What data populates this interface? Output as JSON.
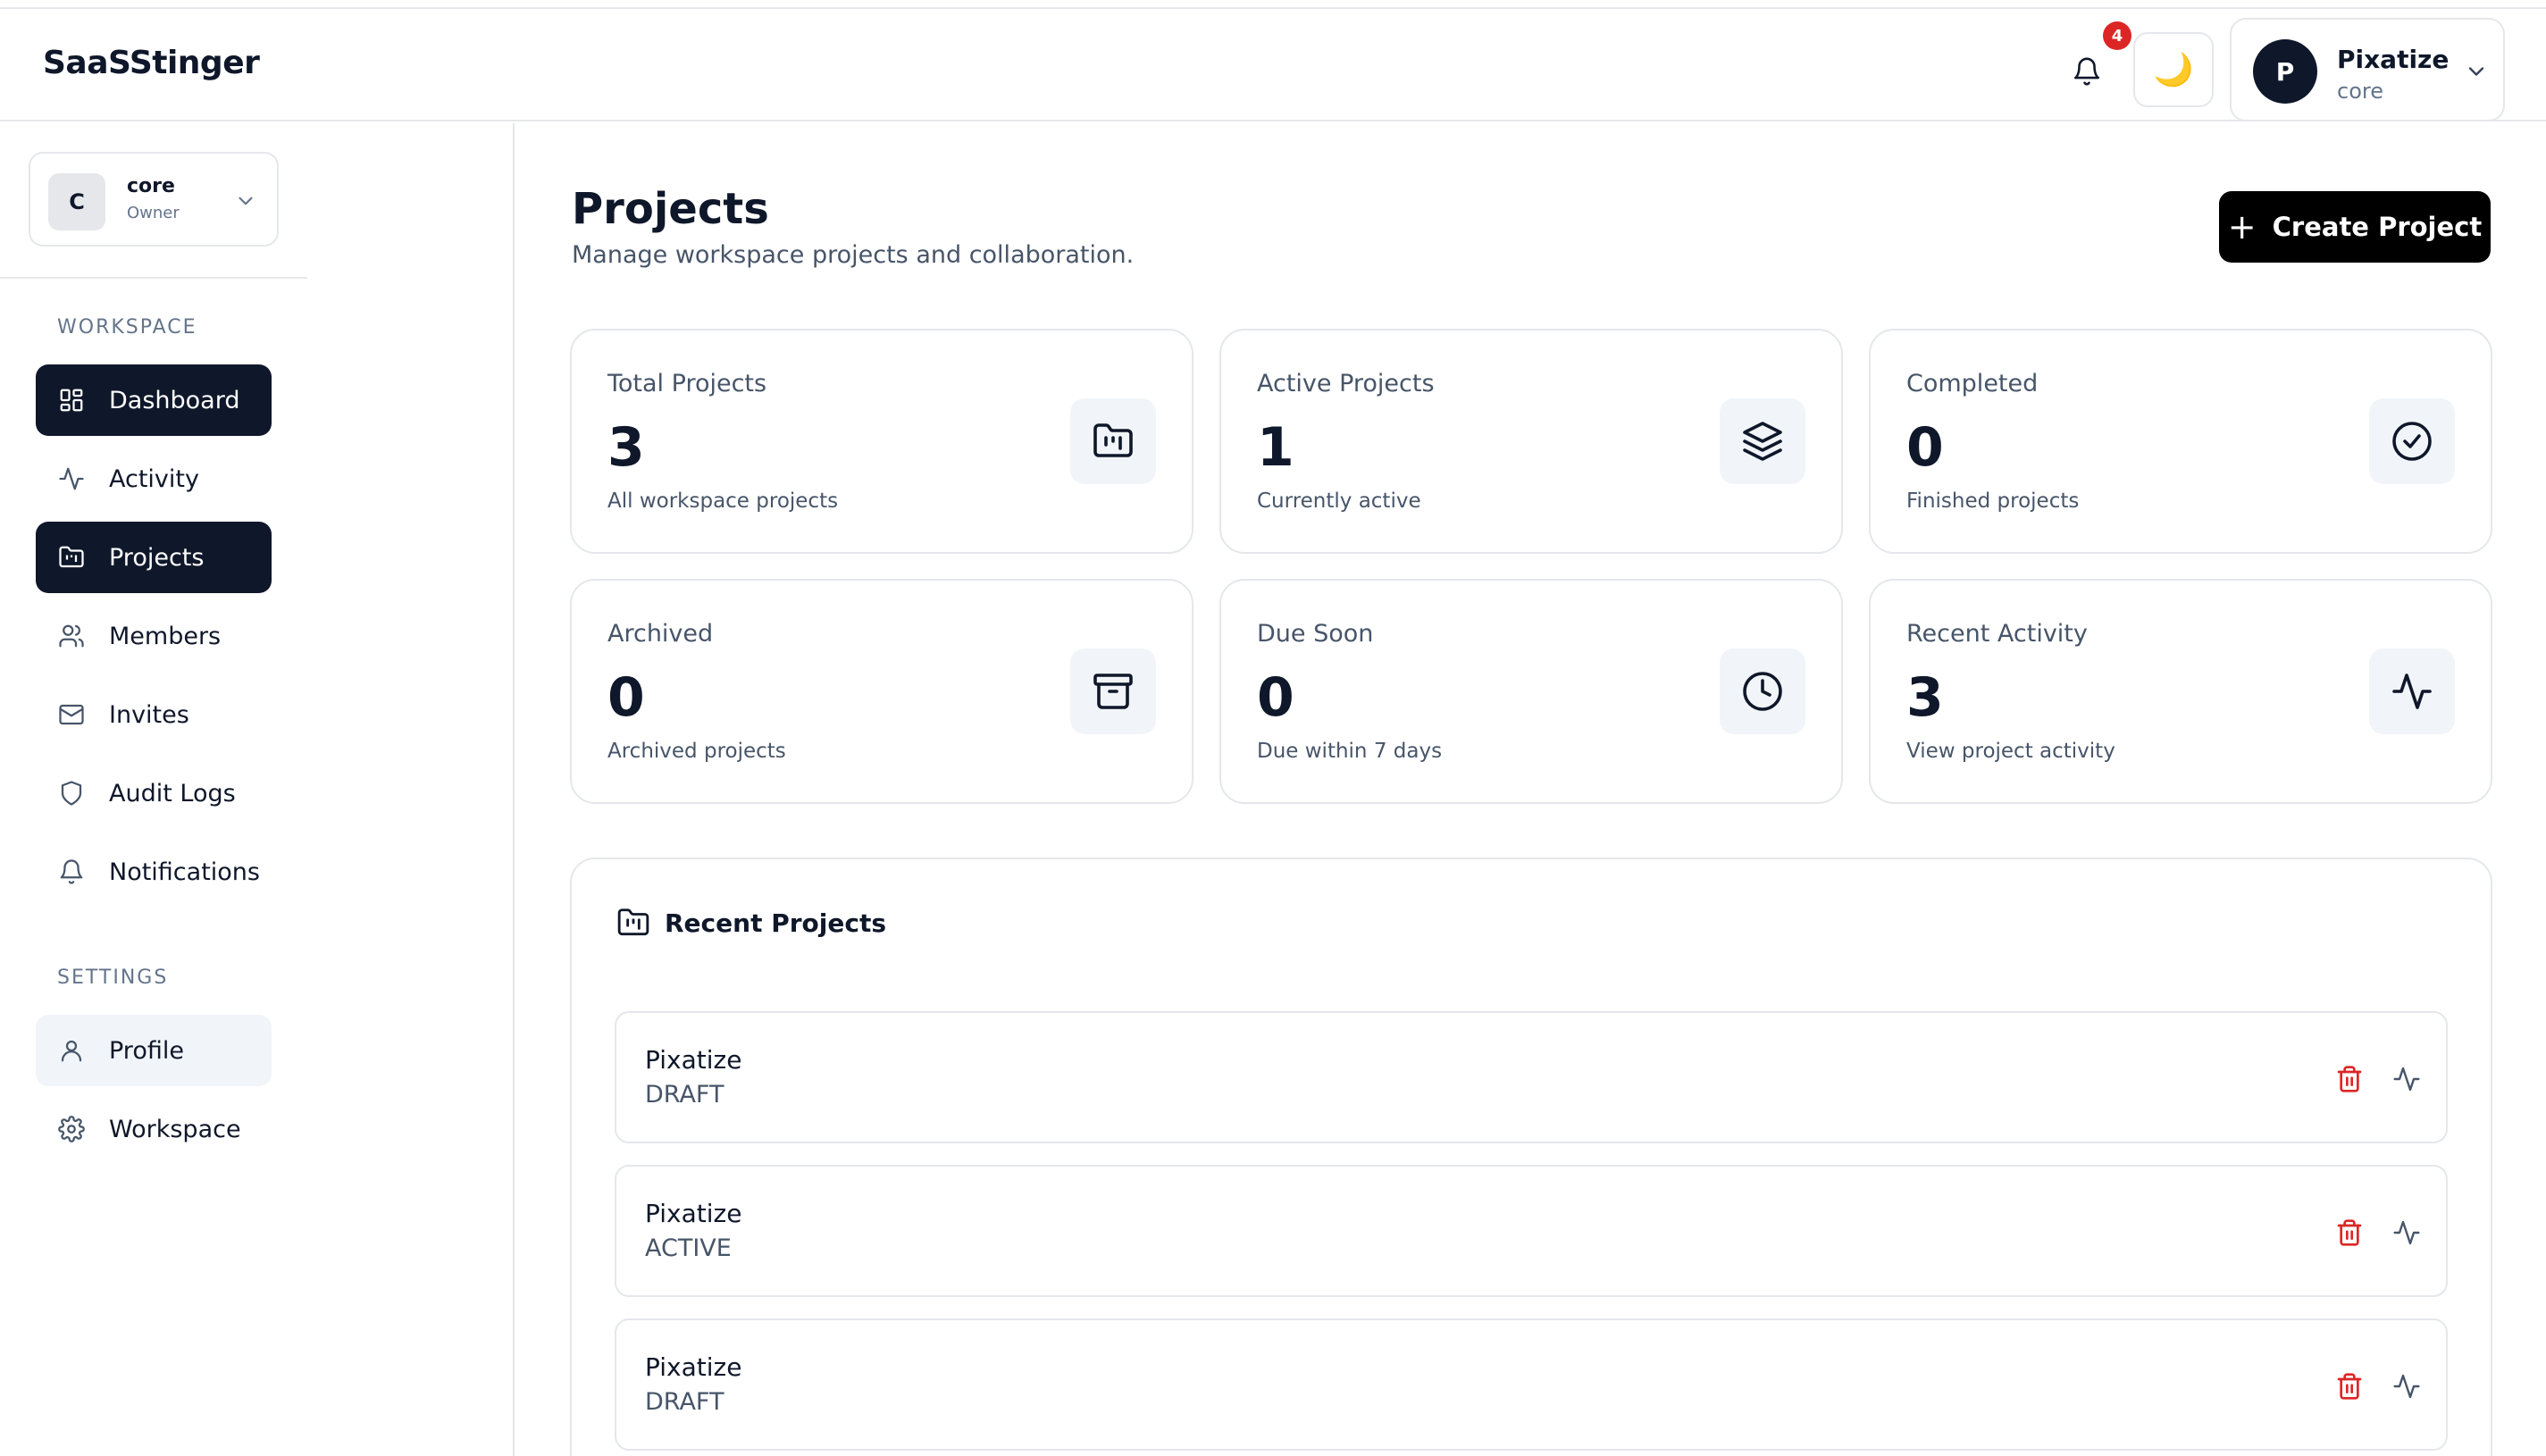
{
  "header": {
    "brand": "SaaSStinger",
    "notification_count": "4",
    "theme_icon": "moon-icon",
    "user": {
      "initial": "P",
      "name": "Pixatize",
      "workspace": "core"
    }
  },
  "sidebar": {
    "workspace_switcher": {
      "initial": "C",
      "name": "core",
      "role": "Owner"
    },
    "section_workspace": "WORKSPACE",
    "section_settings": "SETTINGS",
    "items": [
      {
        "label": "Dashboard",
        "icon": "grid-icon",
        "state": "active"
      },
      {
        "label": "Activity",
        "icon": "activity-icon",
        "state": "normal"
      },
      {
        "label": "Projects",
        "icon": "folder-icon",
        "state": "active"
      },
      {
        "label": "Members",
        "icon": "users-icon",
        "state": "normal"
      },
      {
        "label": "Invites",
        "icon": "mail-icon",
        "state": "normal"
      },
      {
        "label": "Audit Logs",
        "icon": "shield-icon",
        "state": "normal"
      },
      {
        "label": "Notifications",
        "icon": "bell-icon",
        "state": "normal"
      }
    ],
    "settings_items": [
      {
        "label": "Profile",
        "icon": "user-icon",
        "state": "hover"
      },
      {
        "label": "Workspace",
        "icon": "gear-icon",
        "state": "normal"
      }
    ]
  },
  "main": {
    "title": "Projects",
    "subtitle": "Manage workspace projects and collaboration.",
    "create_button": "Create Project",
    "stats": [
      {
        "title": "Total Projects",
        "value": "3",
        "desc": "All workspace projects",
        "icon": "folder-icon"
      },
      {
        "title": "Active Projects",
        "value": "1",
        "desc": "Currently active",
        "icon": "layers-icon"
      },
      {
        "title": "Completed",
        "value": "0",
        "desc": "Finished projects",
        "icon": "check-circle-icon"
      },
      {
        "title": "Archived",
        "value": "0",
        "desc": "Archived projects",
        "icon": "archive-icon"
      },
      {
        "title": "Due Soon",
        "value": "0",
        "desc": "Due within 7 days",
        "icon": "clock-icon"
      },
      {
        "title": "Recent Activity",
        "value": "3",
        "desc": "View project activity",
        "icon": "activity-icon"
      }
    ],
    "recent": {
      "title": "Recent Projects",
      "projects": [
        {
          "name": "Pixatize",
          "status": "DRAFT"
        },
        {
          "name": "Pixatize",
          "status": "ACTIVE"
        },
        {
          "name": "Pixatize",
          "status": "DRAFT"
        }
      ]
    }
  },
  "colors": {
    "primary": "#0f172a",
    "danger": "#dc2626",
    "muted": "#475569",
    "border": "#e5e7eb"
  }
}
